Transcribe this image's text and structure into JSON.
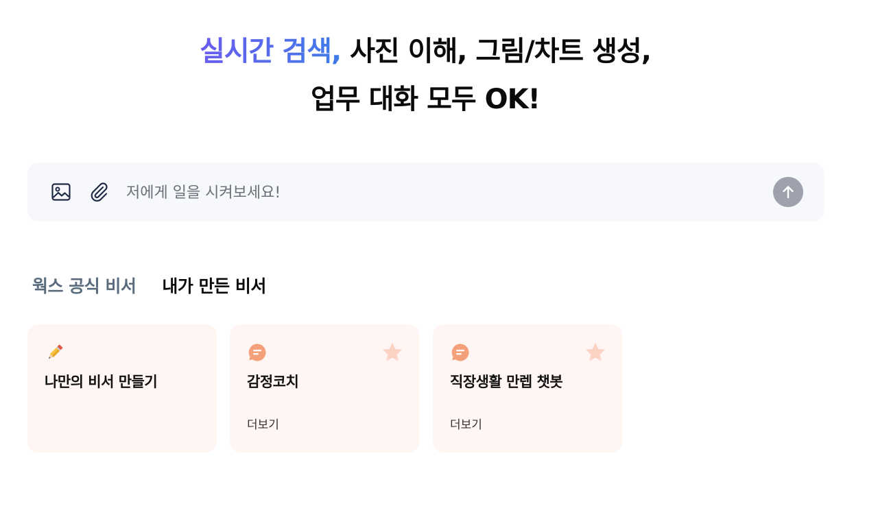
{
  "hero": {
    "line1_accent": "실시간 검색,",
    "line1_rest": " 사진 이해, 그림/차트 생성,",
    "line2": "업무 대화 모두 OK!"
  },
  "composer": {
    "placeholder": "저에게 일을 시켜보세요!",
    "value": "",
    "icons": {
      "image": "image-icon",
      "attach": "paperclip-icon",
      "send": "arrow-up-icon"
    }
  },
  "tabs": [
    {
      "label": "웍스 공식 비서",
      "active": false
    },
    {
      "label": "내가 만든 비서",
      "active": true
    }
  ],
  "cards": [
    {
      "icon": "pencil-icon",
      "title": "나만의 비서 만들기",
      "more": "",
      "favorite": false
    },
    {
      "icon": "chat-bubble-icon",
      "title": "감정코치",
      "more": "더보기",
      "favorite": true
    },
    {
      "icon": "chat-bubble-icon",
      "title": "직장생활 만렙 챗봇",
      "more": "더보기",
      "favorite": true
    }
  ],
  "colors": {
    "accent_start": "#6a5cf0",
    "accent_end": "#3f7be6",
    "card_bg": "#fff5f3",
    "chat_icon": "#f4a07a",
    "star": "#fbd3c4",
    "send_button": "#9ea2ad"
  }
}
